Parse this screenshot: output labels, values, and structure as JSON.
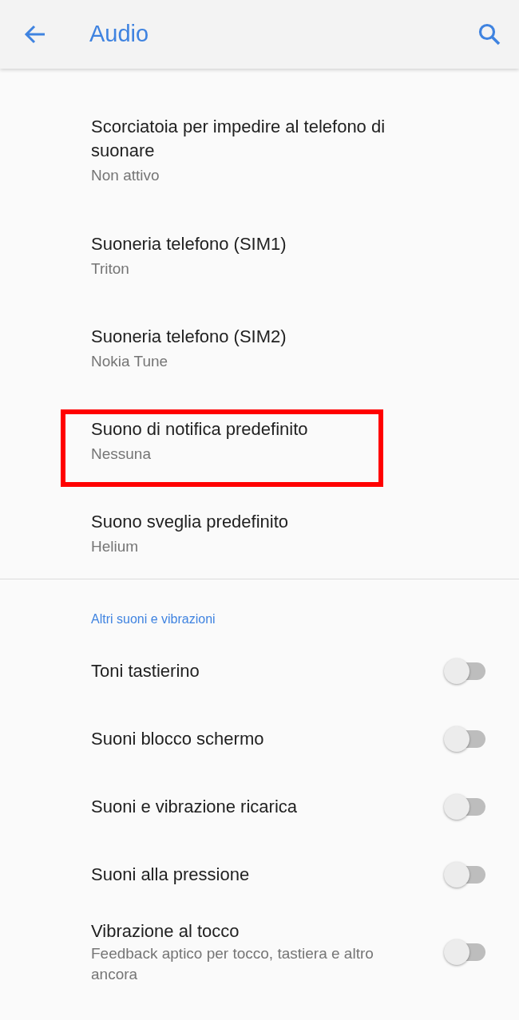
{
  "app_bar": {
    "title": "Audio"
  },
  "preferences": [
    {
      "title": "Scorciatoia per impedire al telefono di suonare",
      "summary": "Non attivo",
      "highlighted": false
    },
    {
      "title": "Suoneria telefono (SIM1)",
      "summary": "Triton",
      "highlighted": false
    },
    {
      "title": "Suoneria telefono (SIM2)",
      "summary": "Nokia Tune",
      "highlighted": false
    },
    {
      "title": "Suono di notifica predefinito",
      "summary": "Nessuna",
      "highlighted": true
    },
    {
      "title": "Suono sveglia predefinito",
      "summary": "Helium",
      "highlighted": false
    }
  ],
  "category": {
    "title": "Altri suoni e vibrazioni"
  },
  "switches": [
    {
      "title": "Toni tastierino",
      "on": false
    },
    {
      "title": "Suoni blocco schermo",
      "on": false
    },
    {
      "title": "Suoni e vibrazione ricarica",
      "on": false
    },
    {
      "title": "Suoni alla pressione",
      "on": false
    },
    {
      "title": "Vibrazione al tocco",
      "summary": "Feedback aptico per tocco, tastiera e altro ancora",
      "on": false
    }
  ]
}
